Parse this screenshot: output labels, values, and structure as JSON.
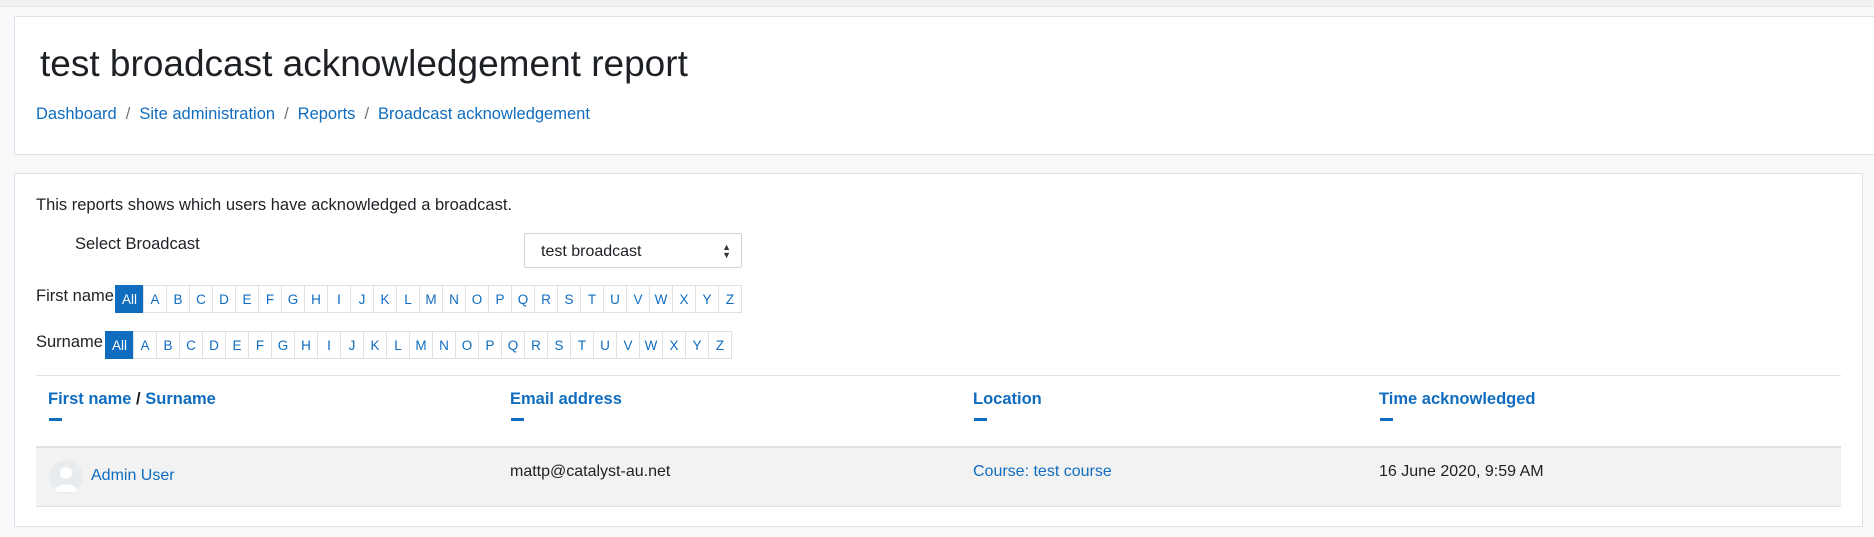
{
  "header": {
    "title": "test broadcast acknowledgement report",
    "breadcrumb": [
      "Dashboard",
      "Site administration",
      "Reports",
      "Broadcast acknowledgement"
    ]
  },
  "report": {
    "intro": "This reports shows which users have acknowledged a broadcast.",
    "select": {
      "label": "Select Broadcast",
      "value": "test broadcast"
    },
    "firstname_bar": {
      "label": "First name",
      "letters": [
        "All",
        "A",
        "B",
        "C",
        "D",
        "E",
        "F",
        "G",
        "H",
        "I",
        "J",
        "K",
        "L",
        "M",
        "N",
        "O",
        "P",
        "Q",
        "R",
        "S",
        "T",
        "U",
        "V",
        "W",
        "X",
        "Y",
        "Z"
      ],
      "selected": "All"
    },
    "surname_bar": {
      "label": "Surname",
      "letters": [
        "All",
        "A",
        "B",
        "C",
        "D",
        "E",
        "F",
        "G",
        "H",
        "I",
        "J",
        "K",
        "L",
        "M",
        "N",
        "O",
        "P",
        "Q",
        "R",
        "S",
        "T",
        "U",
        "V",
        "W",
        "X",
        "Y",
        "Z"
      ],
      "selected": "All"
    },
    "table": {
      "columns": {
        "first_name": "First name",
        "separator": "/",
        "surname": "Surname",
        "email": "Email address",
        "location": "Location",
        "time": "Time acknowledged"
      },
      "rows": [
        {
          "name": "Admin User",
          "email": "mattp@catalyst-au.net",
          "location": "Course: test course",
          "time": "16 June 2020, 9:59 AM"
        }
      ]
    }
  },
  "colors": {
    "link": "#0f6cbf",
    "active_letter_bg": "#0f6cbf",
    "row_bg": "#f2f2f2",
    "border": "#dee2e6"
  }
}
